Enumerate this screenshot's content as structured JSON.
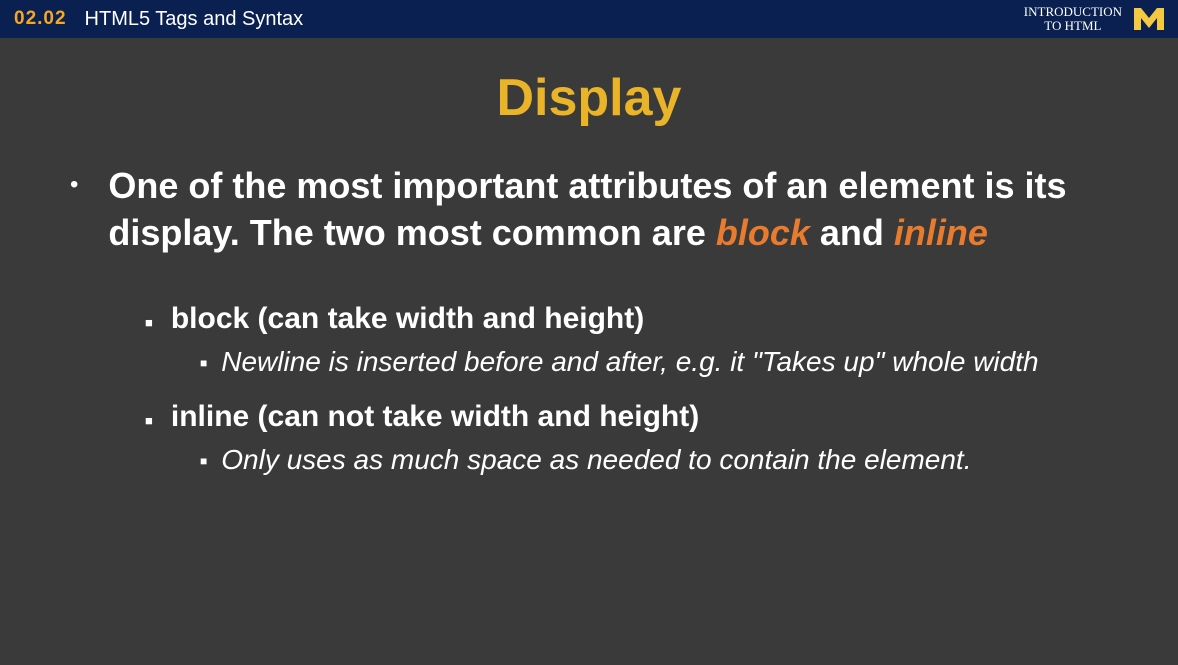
{
  "header": {
    "section_number": "02.02",
    "section_title": "HTML5 Tags and Syntax",
    "course_line1": "INTRODUCTION",
    "course_line2": "TO HTML"
  },
  "slide": {
    "title": "Display",
    "main_bullet_part1": "One of the most important attributes of an element is its display.  The two most common are ",
    "main_bullet_highlight1": "block",
    "main_bullet_part2": " and ",
    "main_bullet_highlight2": "inline",
    "sub1_text": "block (can take width and height)",
    "sub1_detail": "Newline is inserted before and after, e.g. it \"Takes up\" whole width",
    "sub2_text": "inline (can not take width and height)",
    "sub2_detail": "Only uses as much space as needed to contain the element."
  }
}
